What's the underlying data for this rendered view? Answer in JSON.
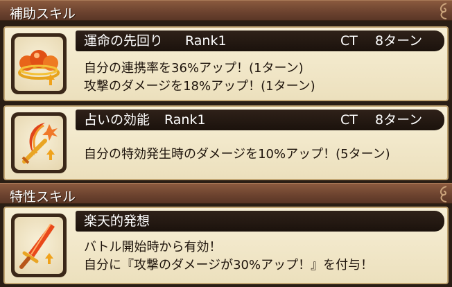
{
  "sections": {
    "support_title": "補助スキル",
    "trait_title": "特性スキル"
  },
  "skills": [
    {
      "name": "運命の先回り",
      "rank": "Rank1",
      "ct_label": "CT",
      "ct_value": "8ターン",
      "lines": [
        "自分の連携率を36%アップ！(1ターン)",
        "攻撃のダメージを18%アップ！(1ターン)"
      ],
      "icon": "orbs-icon"
    },
    {
      "name": "占いの効能",
      "rank": "Rank1",
      "ct_label": "CT",
      "ct_value": "8ターン",
      "lines": [
        "自分の特効発生時のダメージを10%アップ！(5ターン)"
      ],
      "icon": "moon-sword-icon"
    }
  ],
  "trait": {
    "name": "楽天的発想",
    "lines": [
      "バトル開始時から有効！",
      "自分に『攻撃のダメージが30%アップ！』を付与！"
    ],
    "icon": "flame-sword-icon"
  },
  "colors": {
    "header": "#6e4430",
    "card": "#f3e9cb",
    "namebar": "#1f150e",
    "text": "#1e140c"
  }
}
